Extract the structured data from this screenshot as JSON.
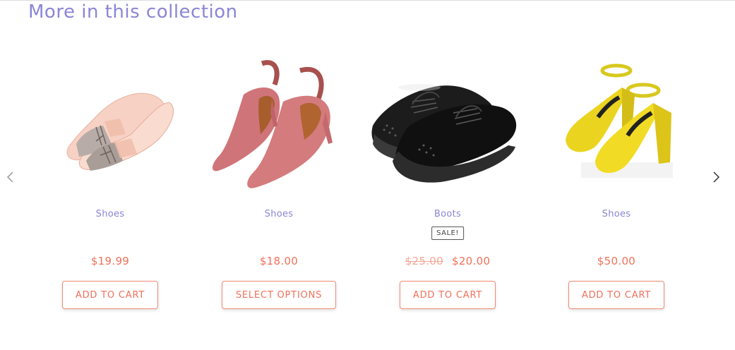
{
  "section": {
    "heading": "More in this collection"
  },
  "carousel": {
    "prev_icon": "chevron-left-icon",
    "next_icon": "chevron-right-icon"
  },
  "products": [
    {
      "category": "Shoes",
      "price": "$19.99",
      "button": "ADD TO CART",
      "image": "pink-snakeskin-loafers"
    },
    {
      "category": "Shoes",
      "price": "$18.00",
      "button": "SELECT OPTIONS",
      "image": "pink-suede-slingback-heels"
    },
    {
      "category": "Boots",
      "badge": "SALE!",
      "old_price": "$25.00",
      "price": "$20.00",
      "button": "ADD TO CART",
      "image": "black-leather-brogues"
    },
    {
      "category": "Shoes",
      "price": "$50.00",
      "button": "ADD TO CART",
      "image": "yellow-ankle-strap-heels"
    }
  ],
  "colors": {
    "accent_purple": "#8a86d6",
    "price_coral": "#f0705a",
    "button_border": "#f08a74"
  }
}
